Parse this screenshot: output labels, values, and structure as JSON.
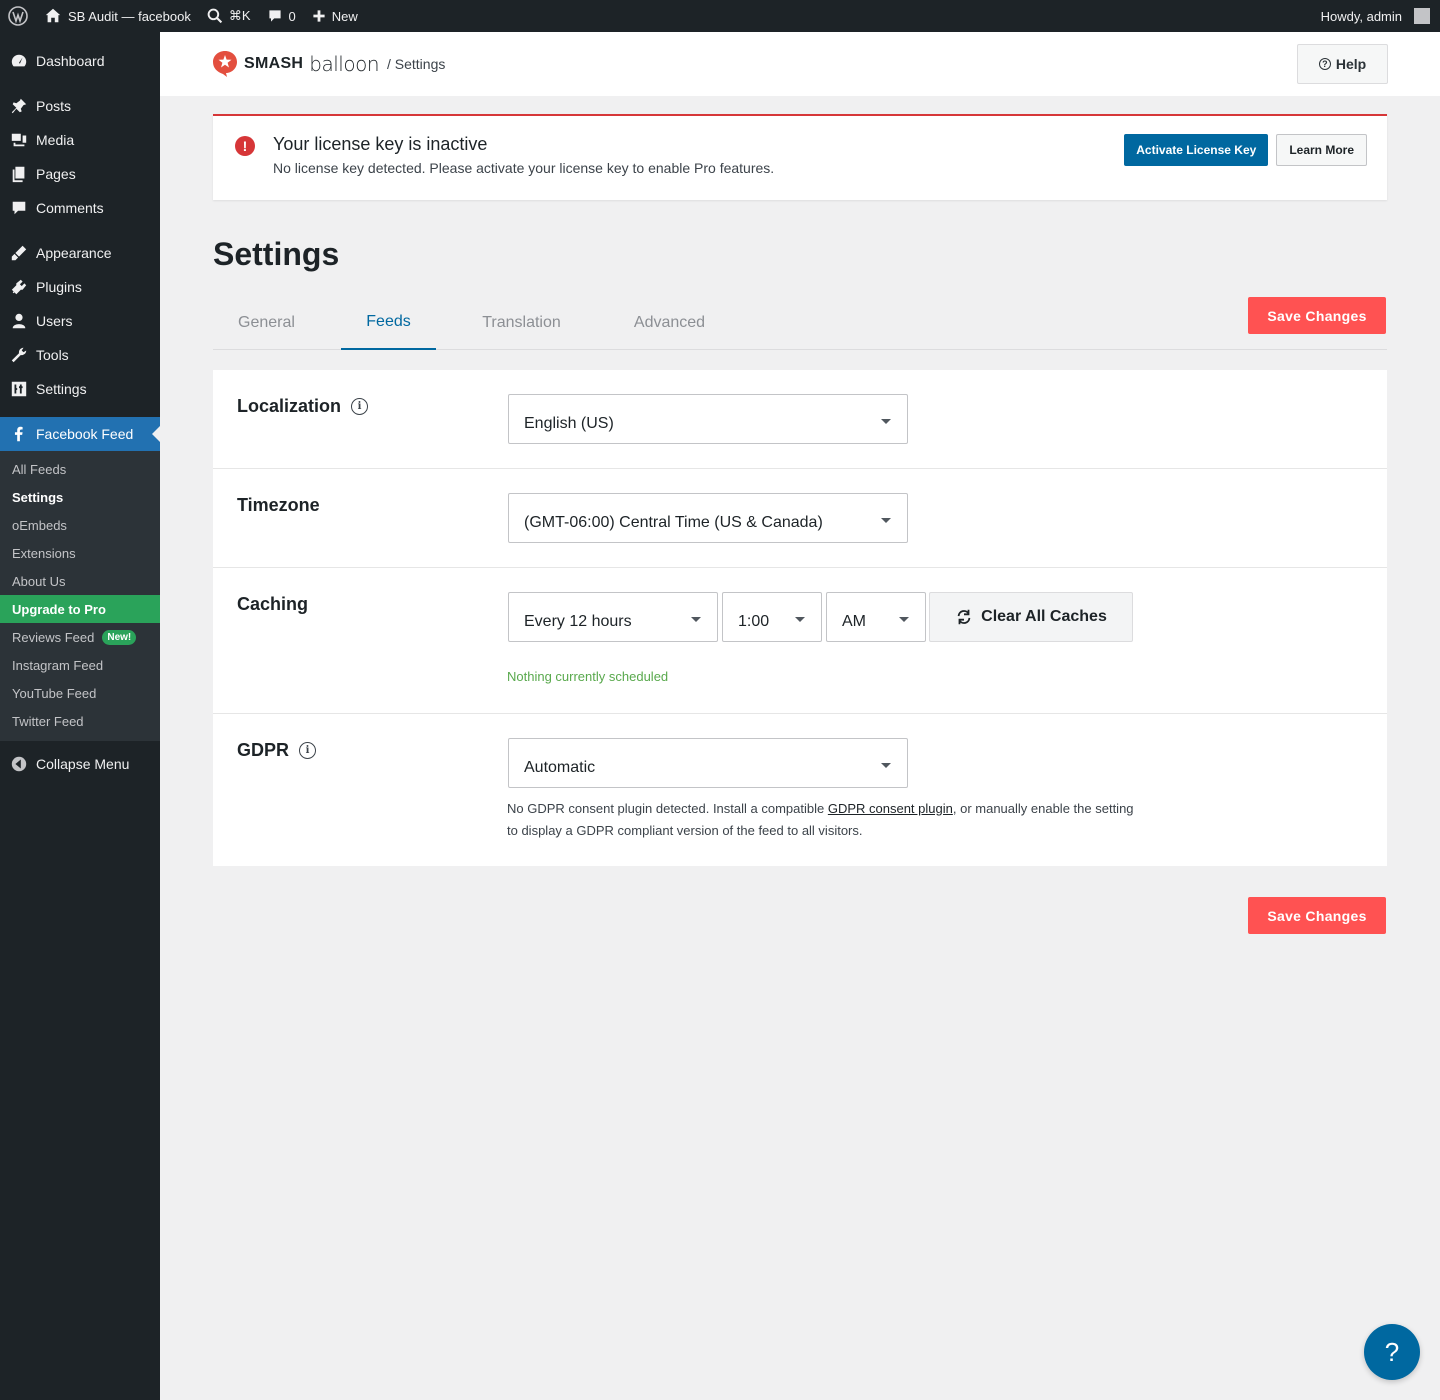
{
  "adminbar": {
    "site_name": "SB Audit — facebook",
    "shortcut": "⌘K",
    "comments_count": "0",
    "new_label": "New",
    "howdy": "Howdy, admin"
  },
  "sidebar": {
    "items": [
      {
        "label": "Dashboard",
        "icon": "dashboard-icon"
      },
      {
        "label": "Posts",
        "icon": "pin-icon"
      },
      {
        "label": "Media",
        "icon": "media-icon"
      },
      {
        "label": "Pages",
        "icon": "pages-icon"
      },
      {
        "label": "Comments",
        "icon": "comment-icon"
      },
      {
        "label": "Appearance",
        "icon": "brush-icon"
      },
      {
        "label": "Plugins",
        "icon": "plugin-icon"
      },
      {
        "label": "Users",
        "icon": "user-icon"
      },
      {
        "label": "Tools",
        "icon": "wrench-icon"
      },
      {
        "label": "Settings",
        "icon": "sliders-icon"
      },
      {
        "label": "Facebook Feed",
        "icon": "facebook-icon"
      }
    ],
    "submenu": [
      "All Feeds",
      "Settings",
      "oEmbeds",
      "Extensions",
      "About Us",
      "Upgrade to Pro",
      "Reviews Feed",
      "Instagram Feed",
      "YouTube Feed",
      "Twitter Feed"
    ],
    "new_badge": "New!",
    "collapse_label": "Collapse Menu"
  },
  "header": {
    "logo_smash": "SMASH",
    "logo_balloon": "balloon",
    "breadcrumb": "/ Settings",
    "help_label": "Help"
  },
  "notice": {
    "title": "Your license key is inactive",
    "description": "No license key detected. Please activate your license key to enable Pro features.",
    "activate_label": "Activate License Key",
    "learn_more_label": "Learn More"
  },
  "page": {
    "title": "Settings",
    "save_label": "Save Changes"
  },
  "tabs": [
    "General",
    "Feeds",
    "Translation",
    "Advanced"
  ],
  "settings": {
    "localization": {
      "label": "Localization",
      "value": "English (US)"
    },
    "timezone": {
      "label": "Timezone",
      "value": "(GMT-06:00) Central Time (US & Canada)"
    },
    "caching": {
      "label": "Caching",
      "interval": "Every 12 hours",
      "time": "1:00",
      "ampm": "AM",
      "clear_label": "Clear All Caches",
      "status": "Nothing currently scheduled"
    },
    "gdpr": {
      "label": "GDPR",
      "value": "Automatic",
      "note_before": "No GDPR consent plugin detected. Install a compatible ",
      "note_link": "GDPR consent plugin",
      "note_after": ", or manually enable the setting to display a GDPR compliant version of the feed to all visitors."
    }
  },
  "float_help": "?"
}
